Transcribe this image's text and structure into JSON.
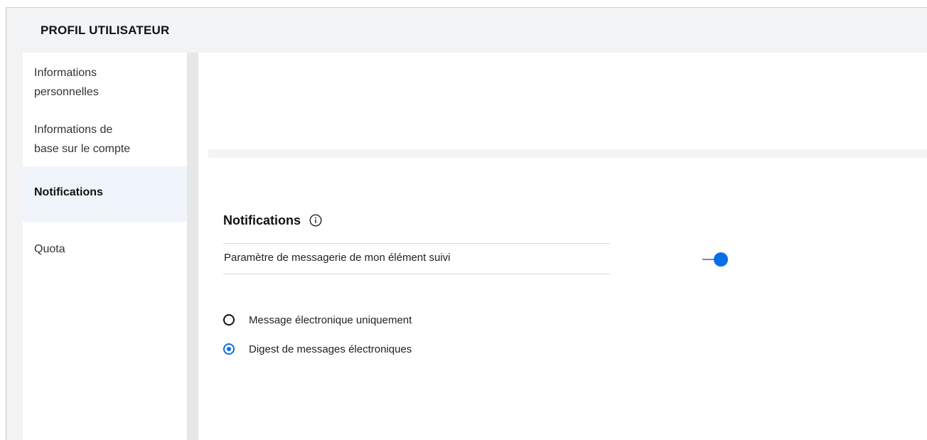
{
  "header": {
    "title": "PROFIL UTILISATEUR"
  },
  "sidebar": {
    "items": [
      {
        "label_line1": "Informations",
        "label_line2": "personnelles",
        "active": false
      },
      {
        "label_line1": "Informations de",
        "label_line2": "base sur le compte",
        "active": false
      },
      {
        "label_line1": "Notifications",
        "label_line2": "",
        "active": true
      },
      {
        "label_line1": "Quota",
        "label_line2": "",
        "active": false
      }
    ]
  },
  "main": {
    "section_title": "Notifications",
    "info_icon": "info-circle-icon",
    "setting": {
      "label": "Paramètre de messagerie de mon élément suivi",
      "toggle_on": true
    },
    "options": [
      {
        "label": "Message électronique uniquement",
        "selected": false
      },
      {
        "label": "Digest de messages électroniques",
        "selected": true
      }
    ]
  },
  "colors": {
    "accent": "#0a6fe6",
    "header_bg": "#f2f3f5",
    "active_nav_bg": "#f0f4fb"
  }
}
